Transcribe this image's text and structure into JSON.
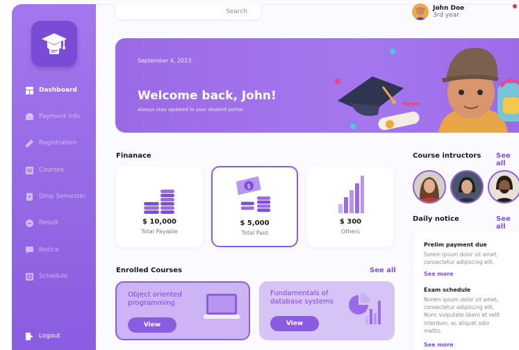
{
  "sidebar": {
    "items": [
      {
        "label": "Dashboard",
        "icon": "dashboard-icon"
      },
      {
        "label": "Payment Info",
        "icon": "payment-icon"
      },
      {
        "label": "Registration",
        "icon": "pen-icon"
      },
      {
        "label": "Courses",
        "icon": "courses-icon"
      },
      {
        "label": "Drop Semester",
        "icon": "document-icon"
      },
      {
        "label": "Result",
        "icon": "result-icon"
      },
      {
        "label": "Notice",
        "icon": "notice-icon"
      },
      {
        "label": "Schedule",
        "icon": "schedule-icon"
      }
    ],
    "logout": "Logout"
  },
  "search": {
    "placeholder": "Search"
  },
  "user": {
    "name": "John Doe",
    "year": "3rd year"
  },
  "banner": {
    "date": "September 4, 2023",
    "title": "Welcome back, John!",
    "subtitle": "Always stay updated in your student portal"
  },
  "finance": {
    "title": "Finanace",
    "cards": [
      {
        "amount": "$ 10,000",
        "label": "Total Payable"
      },
      {
        "amount": "$ 5,000",
        "label": "Total Paid"
      },
      {
        "amount": "$ 300",
        "label": "Others"
      }
    ]
  },
  "courses": {
    "title": "Enrolled Courses",
    "see_all": "See all",
    "items": [
      {
        "title_line1": "Object oriented",
        "title_line2": "programming",
        "button": "View"
      },
      {
        "title_line1": "Fundamentals of",
        "title_line2": "database systems",
        "button": "View"
      }
    ]
  },
  "instructors": {
    "title": "Course intructors",
    "see_all": "See all"
  },
  "notice": {
    "title": "Daily notice",
    "see_all": "See all",
    "items": [
      {
        "title": "Prelim payment due",
        "body_lines": [
          "Sorem ipsum dolor sit amet,",
          "consectetur adipiscing elit."
        ],
        "more": "See more"
      },
      {
        "title": "Exam schedule",
        "body_lines": [
          "Norem ipsum dolor sit amet,",
          "consectetur adipiscing elit.",
          "Nunc vulputate libero et velit",
          "interdum, ac aliquet odio",
          "mattis."
        ],
        "more": "See more"
      }
    ]
  },
  "colors": {
    "accent": "#8a5ce0",
    "sidebar": "#9b6ae8",
    "banner": "#a074ec",
    "link": "#7d4fe0"
  }
}
